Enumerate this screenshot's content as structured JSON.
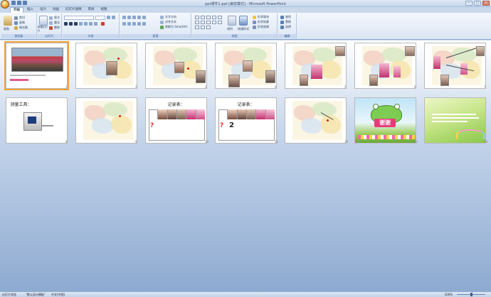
{
  "window": {
    "title": "ppt课件1.ppt [兼容模式] - Microsoft PowerPoint",
    "controls": [
      "−",
      "□",
      "×"
    ]
  },
  "ribbon": {
    "tabs": [
      "开始",
      "插入",
      "设计",
      "动画",
      "幻灯片放映",
      "审阅",
      "视图"
    ],
    "active_tab": "开始",
    "groups": {
      "clipboard": {
        "label": "剪贴板",
        "paste": "粘贴",
        "cut": "剪切",
        "copy": "复制",
        "format_painter": "格式刷"
      },
      "slides": {
        "label": "幻灯片",
        "new_slide": "新建幻灯片",
        "layout": "版式",
        "reset": "重设",
        "delete": "删除"
      },
      "font": {
        "label": "字体"
      },
      "paragraph": {
        "label": "段落",
        "text_direction": "文字方向",
        "align_text": "对齐文本",
        "smartart": "转换为 SmartArt"
      },
      "drawing": {
        "label": "绘图",
        "arrange": "排列",
        "quick_styles": "快速样式",
        "shape_fill": "形状填充",
        "shape_outline": "形状轮廓",
        "shape_effects": "形状效果"
      },
      "editing": {
        "label": "编辑",
        "find": "查找",
        "replace": "替换",
        "select": "选择"
      }
    }
  },
  "slides": [
    {
      "num": "1"
    },
    {
      "num": "2"
    },
    {
      "num": "3"
    },
    {
      "num": "4"
    },
    {
      "num": "5"
    },
    {
      "num": "6"
    },
    {
      "num": "7"
    },
    {
      "num": "8",
      "title": "测量工具："
    },
    {
      "num": "9"
    },
    {
      "num": "10",
      "title": "记录表："
    },
    {
      "num": "11",
      "title": "记录表：",
      "big_digit": "2"
    },
    {
      "num": "12"
    },
    {
      "num": "13",
      "thanks": "谢谢"
    },
    {
      "num": "14"
    }
  ],
  "statusbar": {
    "view": "幻灯片浏览",
    "theme": "\"默认设计模板\"",
    "language": "中文(中国)",
    "zoom": "100%"
  },
  "colors": {
    "ribbon_bg": "#dbe6f4",
    "sorter_top": "#ffffff",
    "sorter_bottom": "#8eaad0",
    "selection": "#f3a23a"
  }
}
